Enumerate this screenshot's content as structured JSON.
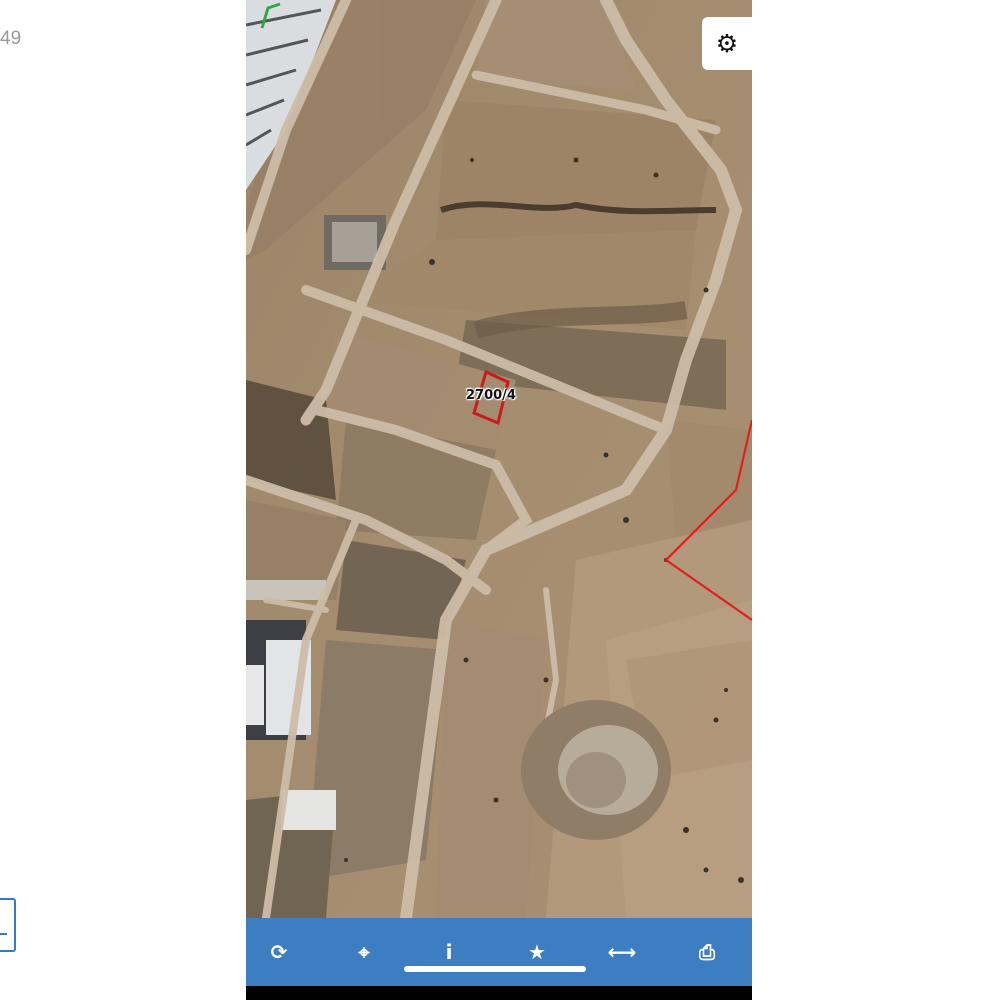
{
  "left_panel": {
    "partial_text": "49"
  },
  "map": {
    "parcel_label": "2700/4",
    "parcel_color": "#cc1a1a",
    "boundary_color": "#e0201c",
    "accent_color": "#2ea84a"
  },
  "toolbar": {
    "background": "#3d7dc1",
    "buttons": [
      {
        "name": "refresh",
        "glyph": "⟳"
      },
      {
        "name": "locate",
        "glyph": "⌖"
      },
      {
        "name": "info",
        "glyph": "i"
      },
      {
        "name": "favorite",
        "glyph": "★"
      },
      {
        "name": "measure",
        "glyph": "⟷"
      },
      {
        "name": "print",
        "glyph": "⎙"
      }
    ]
  },
  "settings": {
    "glyph": "⚙"
  }
}
